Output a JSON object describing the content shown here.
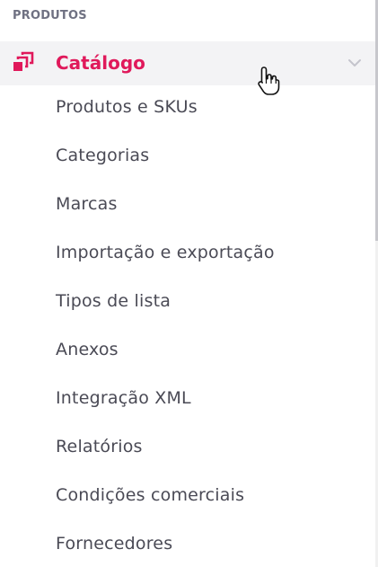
{
  "section": {
    "title": "PRODUTOS"
  },
  "category": {
    "label": "Catálogo",
    "icon": "catalog-icon",
    "expanded": true,
    "accent_color": "#e0195b"
  },
  "submenu": {
    "items": [
      {
        "label": "Produtos e SKUs"
      },
      {
        "label": "Categorias"
      },
      {
        "label": "Marcas"
      },
      {
        "label": "Importação e exportação"
      },
      {
        "label": "Tipos de lista"
      },
      {
        "label": "Anexos"
      },
      {
        "label": "Integração XML"
      },
      {
        "label": "Relatórios"
      },
      {
        "label": "Condições comerciais"
      },
      {
        "label": "Fornecedores"
      }
    ]
  }
}
